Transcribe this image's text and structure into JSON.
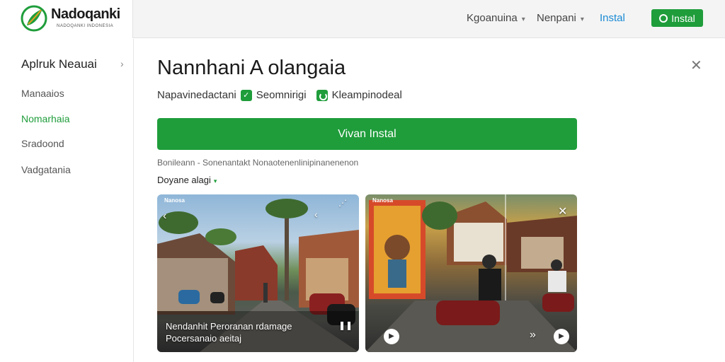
{
  "brand": {
    "name": "Nadoqanki",
    "tagline": "NADOQANKI INDONESIA"
  },
  "topnav": {
    "items": [
      {
        "label": "Kgoanuina"
      },
      {
        "label": "Nenpani"
      }
    ],
    "link": "Instal",
    "install_label": "Instal"
  },
  "sidebar": {
    "header": "Aplruk Neauai",
    "items": [
      {
        "label": "Manaaios",
        "active": false
      },
      {
        "label": "Nomarhaia",
        "active": true
      },
      {
        "label": "Sradoond",
        "active": false
      },
      {
        "label": "Vadgatania",
        "active": false
      }
    ]
  },
  "main": {
    "title": "Nannhani A olangaia",
    "meta": {
      "publisher": "Napavinedactani",
      "badge1": "Seomnirigi",
      "badge2": "Kleampinodeal"
    },
    "install_button": "Vivan Instal",
    "fine_print": "Bonileann - Sonenantakt Nonaotenenlinipinanenenon",
    "dropdown": "Doyane alagi"
  },
  "screenshots": [
    {
      "tag": "Nanosa",
      "caption_line1": "Nendanhit Peroranan rdamage",
      "caption_line2": "Pocersanaio aeitaj"
    },
    {
      "tag": "Nanosa"
    }
  ],
  "colors": {
    "accent": "#1f9d3b",
    "link": "#1a8ad4"
  }
}
